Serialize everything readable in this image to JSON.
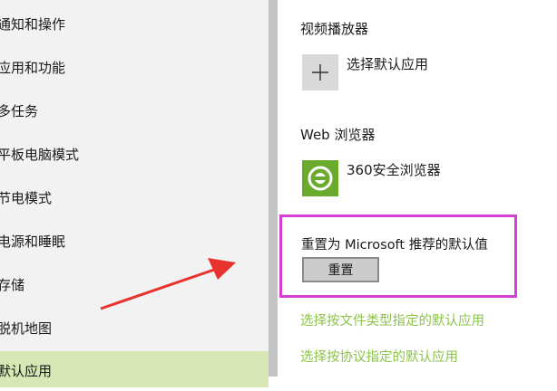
{
  "sidebar": {
    "items": [
      {
        "label": "通知和操作"
      },
      {
        "label": "应用和功能"
      },
      {
        "label": "多任务"
      },
      {
        "label": "平板电脑模式"
      },
      {
        "label": "节电模式"
      },
      {
        "label": "电源和睡眠"
      },
      {
        "label": "存储"
      },
      {
        "label": "脱机地图"
      },
      {
        "label": "默认应用"
      }
    ],
    "active_index": 8
  },
  "main": {
    "video_player": {
      "title": "视频播放器",
      "choose_label": "选择默认应用",
      "icon": "plus-icon"
    },
    "web_browser": {
      "title": "Web 浏览器",
      "app_label": "360安全浏览器",
      "icon": "360-browser-icon"
    },
    "reset": {
      "title": "重置为 Microsoft 推荐的默认值",
      "button_label": "重置"
    },
    "links": {
      "by_file_type": "选择按文件类型指定的默认应用",
      "by_protocol": "选择按协议指定的默认应用"
    }
  },
  "colors": {
    "accent_green": "#8cc34a",
    "active_bg": "#d7e8b4",
    "highlight_box": "#d63fd3",
    "annotation_arrow": "#e8322e"
  }
}
